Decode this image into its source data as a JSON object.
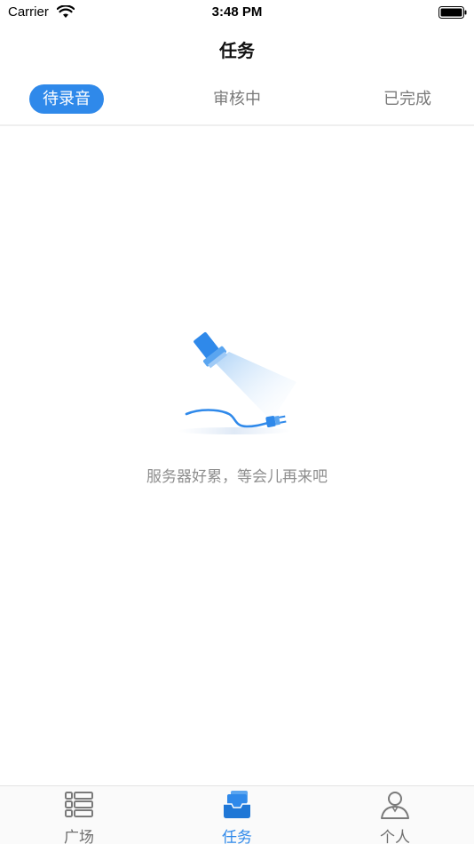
{
  "status_bar": {
    "carrier": "Carrier",
    "time": "3:48 PM"
  },
  "nav": {
    "title": "任务"
  },
  "tabs": [
    {
      "label": "待录音",
      "active": true
    },
    {
      "label": "审核中",
      "active": false
    },
    {
      "label": "已完成",
      "active": false
    }
  ],
  "empty_state": {
    "illustration": "unplugged-flashlight-icon",
    "message": "服务器好累，等会儿再来吧"
  },
  "tab_bar": {
    "items": [
      {
        "label": "广场",
        "icon": "list-icon",
        "active": false
      },
      {
        "label": "任务",
        "icon": "task-stack-icon",
        "active": true
      },
      {
        "label": "个人",
        "icon": "person-icon",
        "active": false
      }
    ]
  },
  "colors": {
    "accent": "#2f89ea",
    "inactive_text": "#7a7a7a",
    "empty_text": "#8e8e8e"
  }
}
